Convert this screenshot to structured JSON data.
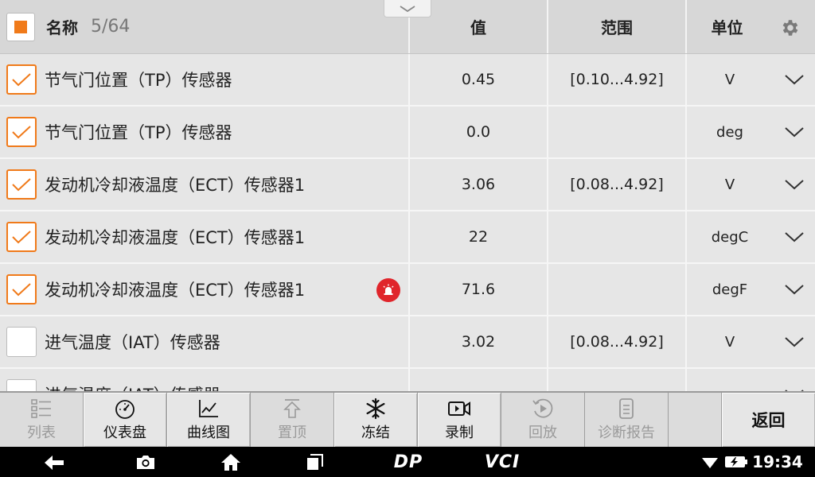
{
  "header": {
    "name_label": "名称",
    "count": "5/64",
    "value_label": "值",
    "range_label": "范围",
    "unit_label": "单位"
  },
  "rows": [
    {
      "name": "节气门位置（TP）传感器",
      "value": "0.45",
      "range": "[0.10...4.92]",
      "unit": "V",
      "checked": true
    },
    {
      "name": "节气门位置（TP）传感器",
      "value": "0.0",
      "range": "",
      "unit": "deg",
      "checked": true
    },
    {
      "name": "发动机冷却液温度（ECT）传感器1",
      "value": "3.06",
      "range": "[0.08...4.92]",
      "unit": "V",
      "checked": true
    },
    {
      "name": "发动机冷却液温度（ECT）传感器1",
      "value": "22",
      "range": "",
      "unit": "degC",
      "checked": true
    },
    {
      "name": "发动机冷却液温度（ECT）传感器1",
      "value": "71.6",
      "range": "",
      "unit": "degF",
      "checked": true,
      "alert": true
    },
    {
      "name": "进气温度（IAT）传感器",
      "value": "3.02",
      "range": "[0.08...4.92]",
      "unit": "V",
      "checked": false
    },
    {
      "name": "进气温度（IAT）传感器",
      "value": "",
      "range": "",
      "unit": "",
      "checked": false
    }
  ],
  "toolbar": {
    "list": "列表",
    "dashboard": "仪表盘",
    "graph": "曲线图",
    "pin_top": "置顶",
    "freeze": "冻结",
    "record": "录制",
    "playback": "回放",
    "report": "诊断报告",
    "back": "返回"
  },
  "navbar": {
    "brand_left": "DP",
    "brand_right": "VCI",
    "time": "19:34"
  },
  "colors": {
    "accent": "#f07a1a",
    "alert": "#e0252b",
    "header_bg": "#d7d7d7",
    "row_bg": "#e6e6e6"
  }
}
